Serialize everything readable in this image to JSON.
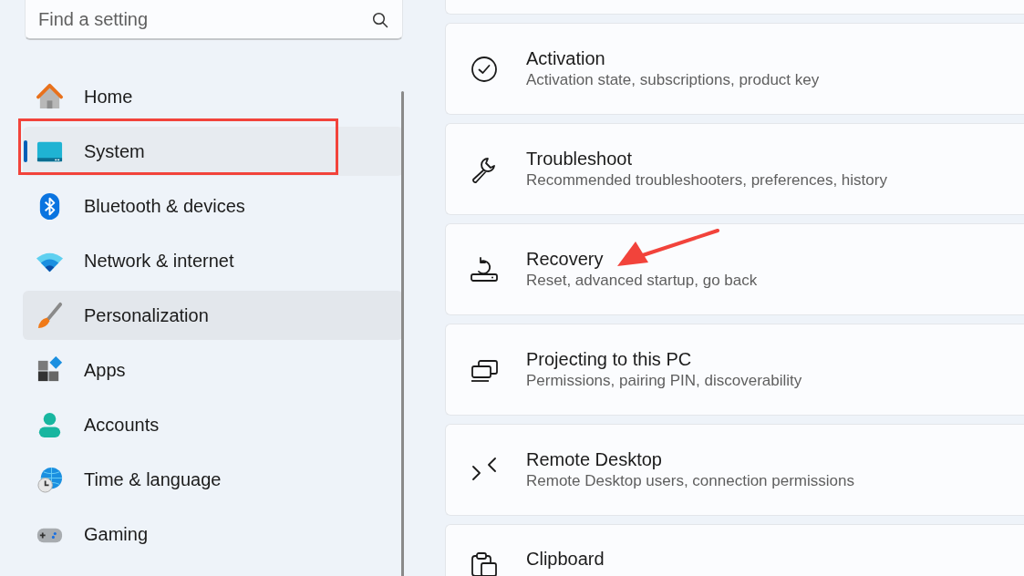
{
  "search": {
    "placeholder": "Find a setting"
  },
  "nav": {
    "items": [
      {
        "label": "Home",
        "selected": false,
        "hovered": false
      },
      {
        "label": "System",
        "selected": true,
        "hovered": false
      },
      {
        "label": "Bluetooth & devices",
        "selected": false,
        "hovered": false
      },
      {
        "label": "Network & internet",
        "selected": false,
        "hovered": false
      },
      {
        "label": "Personalization",
        "selected": false,
        "hovered": true
      },
      {
        "label": "Apps",
        "selected": false,
        "hovered": false
      },
      {
        "label": "Accounts",
        "selected": false,
        "hovered": false
      },
      {
        "label": "Time & language",
        "selected": false,
        "hovered": false
      },
      {
        "label": "Gaming",
        "selected": false,
        "hovered": false
      }
    ]
  },
  "settings": [
    {
      "title": "Activation",
      "subtitle": "Activation state, subscriptions, product key"
    },
    {
      "title": "Troubleshoot",
      "subtitle": "Recommended troubleshooters, preferences, history"
    },
    {
      "title": "Recovery",
      "subtitle": "Reset, advanced startup, go back"
    },
    {
      "title": "Projecting to this PC",
      "subtitle": "Permissions, pairing PIN, discoverability"
    },
    {
      "title": "Remote Desktop",
      "subtitle": "Remote Desktop users, connection permissions"
    },
    {
      "title": "Clipboard"
    }
  ]
}
